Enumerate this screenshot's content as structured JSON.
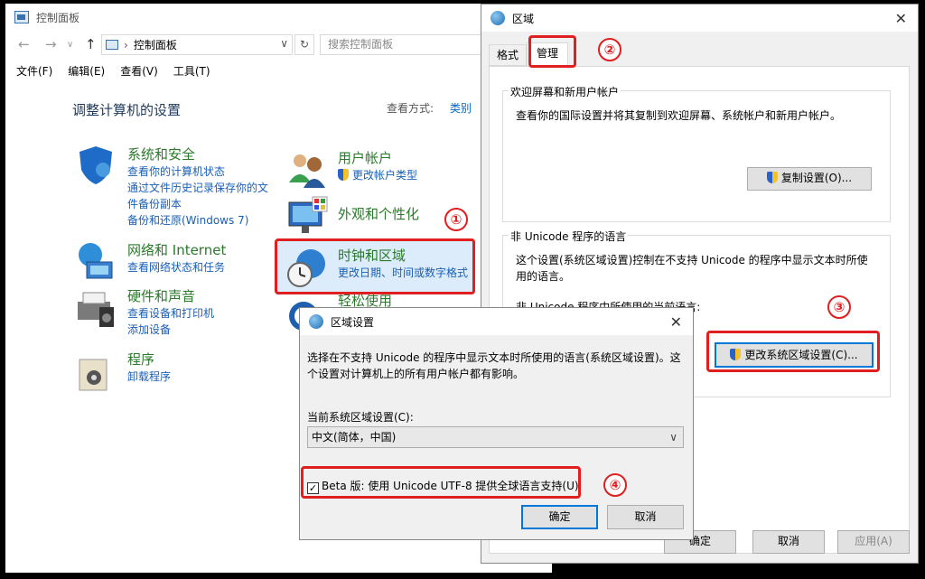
{
  "control_panel": {
    "title": "控制面板",
    "address": "控制面板",
    "search_placeholder": "搜索控制面板",
    "menu": [
      "文件(F)",
      "编辑(E)",
      "查看(V)",
      "工具(T)"
    ],
    "heading": "调整计算机的设置",
    "view_by_label": "查看方式:",
    "view_by_value": "类别",
    "categories": [
      {
        "title": "系统和安全",
        "links": [
          "查看你的计算机状态",
          "通过文件历史记录保存你的文",
          "件备份副本",
          "备份和还原(Windows 7)"
        ]
      },
      {
        "title": "网络和 Internet",
        "links": [
          "查看网络状态和任务"
        ]
      },
      {
        "title": "硬件和声音",
        "links": [
          "查看设备和打印机",
          "添加设备"
        ]
      },
      {
        "title": "程序",
        "links": [
          "卸载程序"
        ]
      },
      {
        "title": "用户帐户",
        "links": [
          "更改帐户类型"
        ]
      },
      {
        "title": "外观和个性化",
        "links": []
      },
      {
        "title": "时钟和区域",
        "links": [
          "更改日期、时间或数字格式"
        ]
      },
      {
        "title": "轻松使用",
        "links": []
      }
    ]
  },
  "region_dialog": {
    "title": "区域",
    "tabs": [
      "格式",
      "管理"
    ],
    "welcome_group": {
      "label": "欢迎屏幕和新用户帐户",
      "text": "查看你的国际设置并将其复制到欢迎屏幕、系统帐户和新用户帐户。",
      "button": "复制设置(O)..."
    },
    "nonunicode_group": {
      "label": "非 Unicode 程序的语言",
      "text": "这个设置(系统区域设置)控制在不支持 Unicode 的程序中显示文本时所使用的语言。",
      "current_label": "非 Unicode 程序中所使用的当前语言:",
      "button": "更改系统区域设置(C)..."
    },
    "ok": "确定",
    "cancel": "取消",
    "apply": "应用(A)"
  },
  "region_settings": {
    "title": "区域设置",
    "text": "选择在不支持 Unicode 的程序中显示文本时所使用的语言(系统区域设置)。这个设置对计算机上的所有用户帐户都有影响。",
    "current_label": "当前系统区域设置(C):",
    "current_value": "中文(简体，中国)",
    "beta_label": "Beta 版: 使用 Unicode UTF-8 提供全球语言支持(U)",
    "ok": "确定",
    "cancel": "取消"
  },
  "annotations": [
    "①",
    "②",
    "③",
    "④"
  ]
}
